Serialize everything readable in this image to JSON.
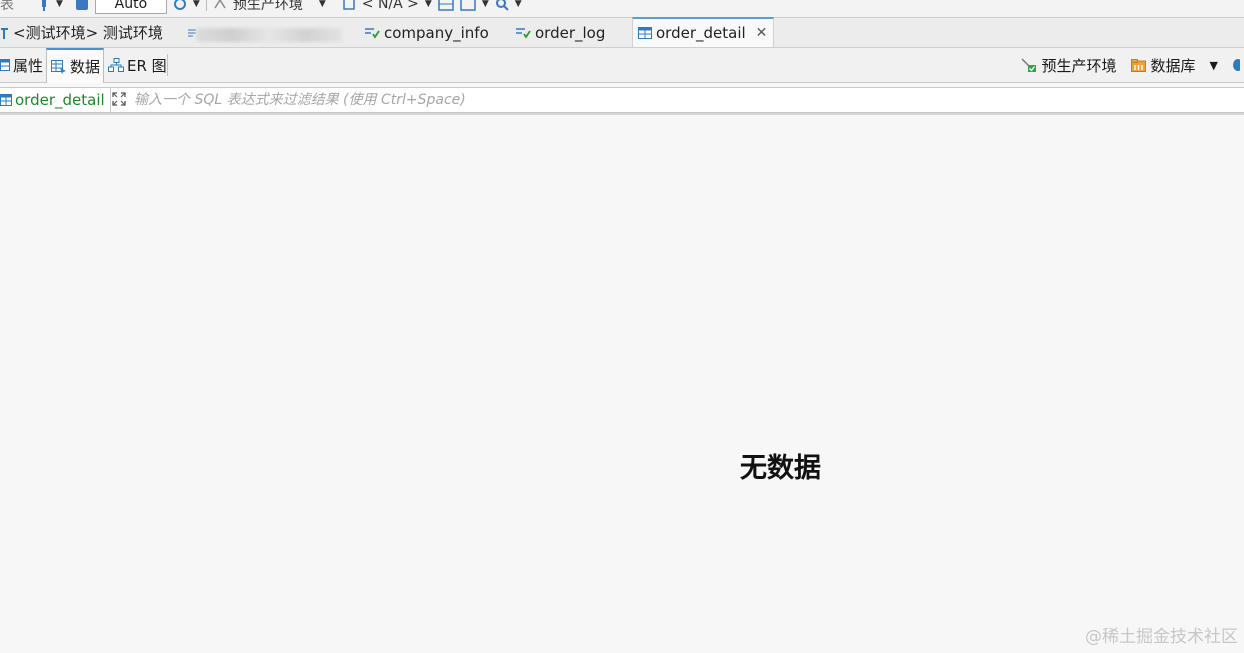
{
  "toolbar": {
    "left_label": "表",
    "auto_combo": "Auto",
    "env_label": "预生产环境",
    "schema_label": "< N/A >"
  },
  "editor_tabs": [
    {
      "label": "<测试环境> 测试环境",
      "icon": "schema-icon"
    },
    {
      "label": "",
      "icon": "sql-script-icon",
      "blurred": true
    },
    {
      "label": "company_info",
      "icon": "sql-editor-icon"
    },
    {
      "label": "order_log",
      "icon": "sql-editor-icon"
    },
    {
      "label": "order_detail",
      "icon": "table-icon",
      "active": true
    }
  ],
  "sub_tabs": {
    "properties": "属性",
    "data": "数据",
    "er": "ER 图"
  },
  "right_tools": {
    "env": "预生产环境",
    "database": "数据库"
  },
  "filter": {
    "table_name": "order_detail",
    "placeholder": "输入一个 SQL 表达式来过滤结果 (使用 Ctrl+Space)"
  },
  "content": {
    "empty_message": "无数据"
  },
  "watermark": "@稀土掘金技术社区",
  "colors": {
    "accent": "#1a8a2a",
    "active_tab_border": "#4d8fd0",
    "table_icon": "#2b7bbf",
    "database_icon": "#e89a2c"
  }
}
